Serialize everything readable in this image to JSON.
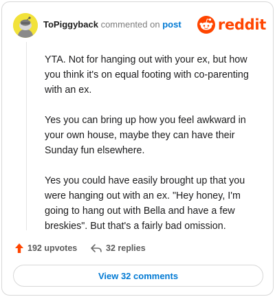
{
  "header": {
    "author": "ToPiggyback",
    "action": "commented on",
    "target": "post",
    "avatar_icon": "snoo-avatar-icon",
    "brand": {
      "icon": "reddit-logo-icon",
      "text": "reddit",
      "color": "#ff4500"
    }
  },
  "comment": {
    "paragraphs": [
      "YTA. Not for hanging out with your ex, but how you think it's on equal footing with co-parenting with an ex.",
      "Yes you can bring up how you feel awkward in your own house, maybe they can have their Sunday fun elsewhere.",
      "Yes you could have easily brought up that you were hanging out with an ex. \"Hey honey, I'm going to hang out with Bella and have a few breskies\". But that's a fairly bad omission."
    ]
  },
  "footer": {
    "upvotes": "192 upvotes",
    "upvote_icon": "upvote-arrow-icon",
    "replies": "32 replies",
    "reply_icon": "reply-arrow-icon",
    "view_button": "View 32 comments"
  },
  "colors": {
    "accent": "#0079d3",
    "upvote": "#ff4500",
    "avatar": "#f2e23a"
  }
}
